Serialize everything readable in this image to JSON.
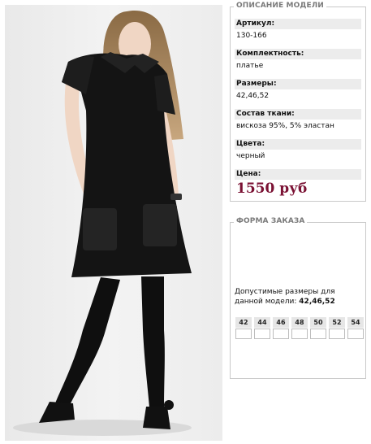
{
  "description": {
    "legend": "ОПИСАНИЕ МОДЕЛИ",
    "fields": [
      {
        "label": "Артикул:",
        "value": "130-166"
      },
      {
        "label": "Комплектность:",
        "value": "платье"
      },
      {
        "label": "Размеры:",
        "value": "42,46,52"
      },
      {
        "label": "Состав ткани:",
        "value": "вискоза 95%, 5% эластан"
      },
      {
        "label": "Цвета:",
        "value": "черный"
      }
    ],
    "price_label": "Цена:",
    "price_value": "1550 руб",
    "price_color": "#7b1234"
  },
  "order": {
    "legend": "ФОРМА ЗАКАЗА",
    "sizes_text": "Допустимые размеры для данной модели:",
    "sizes_value": "42,46,52",
    "sizes": [
      "42",
      "44",
      "46",
      "48",
      "50",
      "52",
      "54"
    ]
  },
  "photo": {
    "icon": "model-photo"
  }
}
